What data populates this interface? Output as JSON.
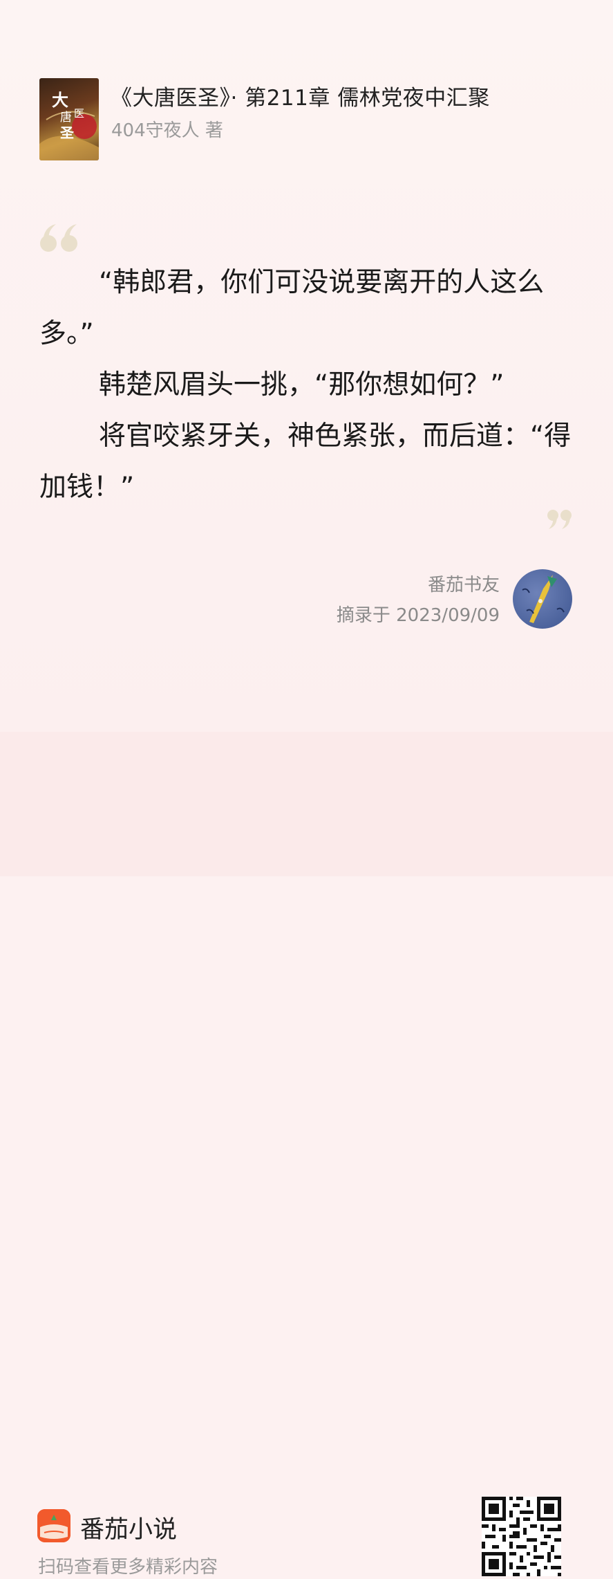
{
  "book": {
    "title": "《大唐医圣》· 第211章 儒林党夜中汇聚",
    "author": "404守夜人 著",
    "cover_text": "大唐医圣"
  },
  "excerpt": {
    "paragraphs": [
      "“韩郎君，你们可没说要离开的人这么多。”",
      "韩楚风眉头一挑，“那你想如何？”",
      "将官咬紧牙关，神色紧张，而后道：“得加钱！”"
    ],
    "quote_color": "#e8dcc6"
  },
  "sharer": {
    "name": "番茄书友",
    "date_label": "摘录于 2023/09/09"
  },
  "footer": {
    "app_name": "番茄小说",
    "slogan": "扫码查看更多精彩内容",
    "brand_color": "#f25a2c"
  }
}
